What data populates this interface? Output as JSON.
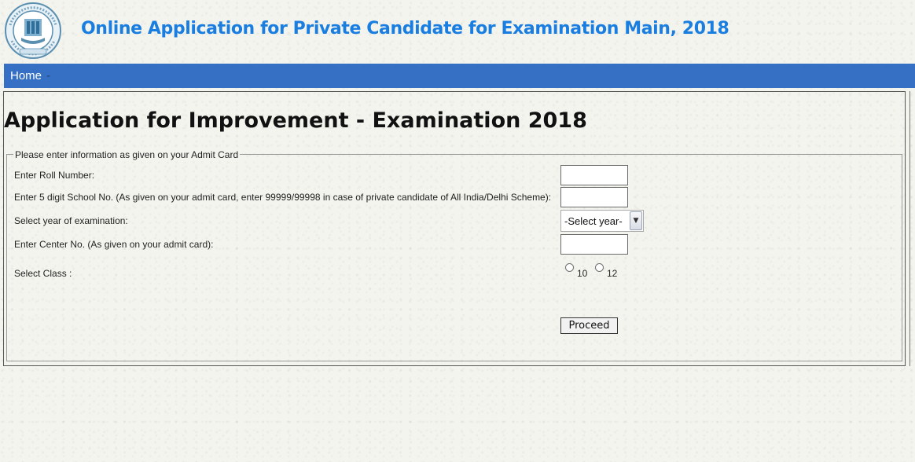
{
  "header": {
    "logo_icon": "cbse-emblem-icon",
    "app_title": "Online Application for Private Candidate for Examination Main, 2018",
    "title_color": "#1a7ee0"
  },
  "navbar": {
    "color": "#3670c5",
    "home_label": "Home",
    "separator": "-"
  },
  "page": {
    "heading": "Application for Improvement - Examination 2018"
  },
  "form": {
    "legend": "Please enter information as given on your Admit Card",
    "roll_number_label": "Enter Roll Number:",
    "roll_number_value": "",
    "school_no_label": "Enter 5 digit School No. (As given on your admit card, enter 99999/99998 in case of private candidate of All India/Delhi Scheme):",
    "school_no_value": "",
    "year_label": "Select year of examination:",
    "year_selected": "-Select year-",
    "center_no_label": "Enter Center No. (As given on your admit card):",
    "center_no_value": "",
    "class_label": "Select Class :",
    "class_options": [
      "10",
      "12"
    ],
    "proceed_label": "Proceed"
  }
}
